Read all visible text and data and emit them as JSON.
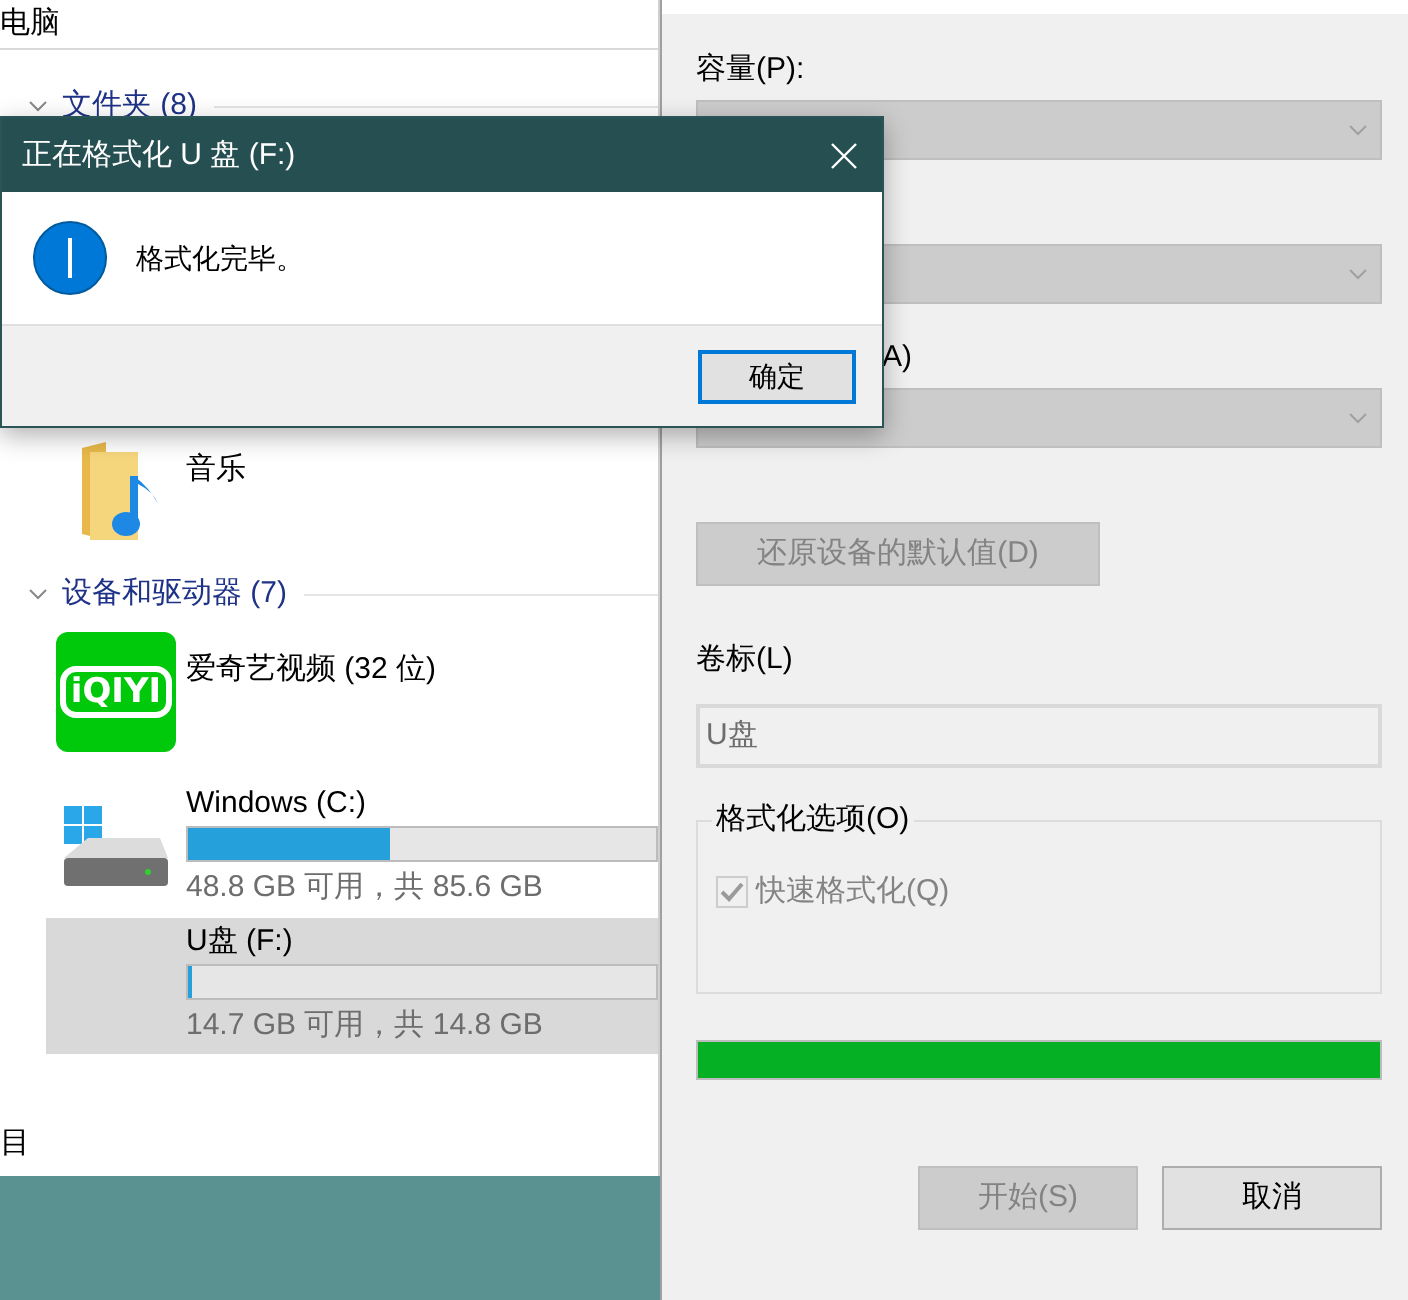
{
  "explorer": {
    "header": "电脑",
    "groups": [
      {
        "label": "文件夹 (8)",
        "expanded": true,
        "items": [
          {
            "kind": "folder",
            "name": "音乐",
            "selected": false
          }
        ]
      },
      {
        "label": "设备和驱动器 (7)",
        "expanded": true,
        "items": [
          {
            "kind": "app",
            "name": "爱奇艺视频 (32 位)",
            "logo_text": "iQIYI",
            "selected": false
          },
          {
            "kind": "drive",
            "name": "Windows (C:)",
            "system_drive": true,
            "level": 0.43,
            "space": "48.8 GB 可用，共 85.6 GB",
            "selected": false
          },
          {
            "kind": "drive",
            "name": "U盘 (F:)",
            "system_drive": false,
            "level": 0.007,
            "space": "14.7 GB 可用，共 14.8 GB",
            "selected": true
          }
        ]
      }
    ],
    "status": "目"
  },
  "format": {
    "fields": [
      {
        "kind": "dropdown",
        "label": "容量(P):",
        "disabled": true
      },
      {
        "kind": "dropdown",
        "disabled": true
      },
      {
        "kind": "dropdown",
        "label": "A)",
        "disabled": true
      }
    ],
    "restore_button": {
      "label": "还原设备的默认值(D)",
      "disabled": true
    },
    "volume_label": {
      "label": "卷标(L)",
      "value": "U盘",
      "disabled": true
    },
    "options": {
      "title": "格式化选项(O)",
      "quick_format": {
        "label": "快速格式化(Q)",
        "checked": true,
        "disabled": true
      }
    },
    "progress": {
      "level": 1
    },
    "buttons": [
      {
        "label": "开始(S)",
        "disabled": true
      },
      {
        "label": "取消",
        "disabled": false
      }
    ]
  },
  "dialog": {
    "title": "正在格式化 U 盘 (F:)",
    "message": "格式化完毕。",
    "button": {
      "label": "确定",
      "focused": true
    }
  }
}
